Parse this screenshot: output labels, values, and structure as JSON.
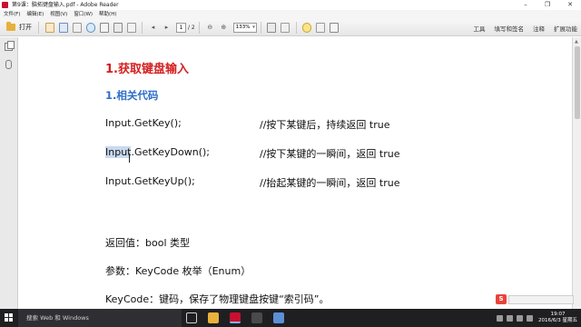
{
  "window": {
    "title": "第9课：脑拓键盘输入.pdf - Adobe Reader"
  },
  "menu": {
    "items": [
      "文件(F)",
      "编辑(E)",
      "视图(V)",
      "窗口(W)",
      "帮助(H)"
    ]
  },
  "toolbar": {
    "open_label": "打开",
    "page_current": "1",
    "page_total": "/ 2",
    "zoom_value": "133%",
    "right_links": [
      "工具",
      "填写和签名",
      "注释",
      "扩展功能"
    ]
  },
  "document": {
    "heading": "1.获取键盘输入",
    "subheading": "1.相关代码",
    "code_lines": [
      {
        "code": "Input.GetKey();",
        "comment": "//按下某键后，持续返回 true"
      },
      {
        "code_highlight": "Input",
        "code_rest": ".GetKeyDown();",
        "comment": "//按下某键的一瞬间，返回 true"
      },
      {
        "code": "Input.GetKeyUp();",
        "comment": "//抬起某键的一瞬间，返回 true"
      }
    ],
    "paragraphs": [
      "返回值：bool 类型",
      "参数：KeyCode 枚举（Enum）",
      "KeyCode：键码，保存了物理键盘按键“索引码”。"
    ]
  },
  "taskbar": {
    "search_placeholder": "搜索 Web 和 Windows",
    "time": "19:07",
    "date": "2016/6/3 星期五",
    "ime_badge": "S"
  },
  "colors": {
    "heading": "#d42020",
    "subheading": "#2e6ec8",
    "taskbar": "#1f1f22",
    "selection": "#c8d9f0"
  }
}
